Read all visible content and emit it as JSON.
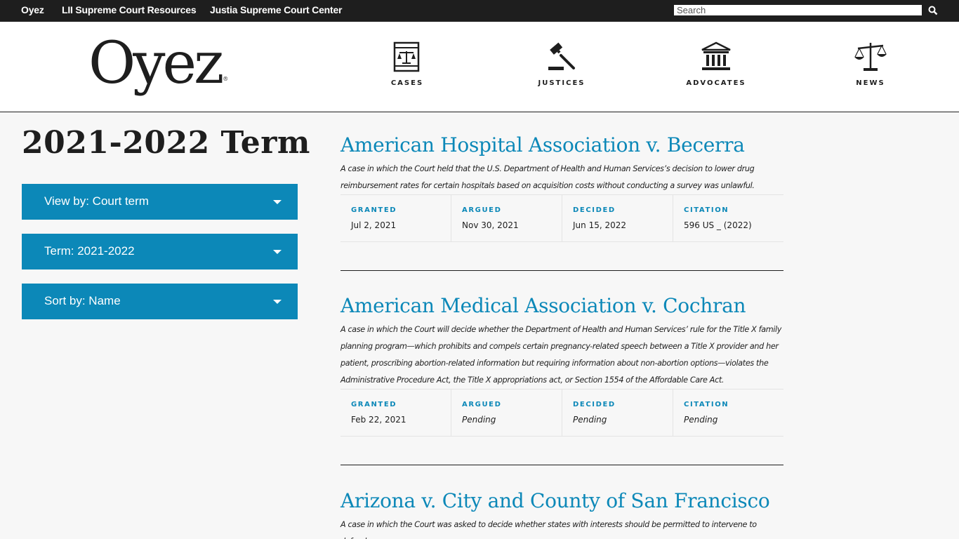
{
  "topbar": {
    "links": [
      "Oyez",
      "LII Supreme Court Resources",
      "Justia Supreme Court Center"
    ],
    "search_placeholder": "Search"
  },
  "header": {
    "logo": "Oyez",
    "nav": [
      "CASES",
      "JUSTICES",
      "ADVOCATES",
      "NEWS"
    ]
  },
  "sidebar": {
    "term_title": "2021-2022 Term",
    "view_by": "View by: Court term",
    "term": "Term: 2021-2022",
    "sort_by": "Sort by: Name"
  },
  "meta_labels": {
    "granted": "GRANTED",
    "argued": "ARGUED",
    "decided": "DECIDED",
    "citation": "CITATION"
  },
  "cases": [
    {
      "title": "American Hospital Association v. Becerra",
      "description": "A case in which the Court held that the U.S. Department of Health and Human Services’s decision to lower drug reimbursement rates for certain hospitals based on acquisition costs without conducting a survey was unlawful.",
      "granted": "Jul 2, 2021",
      "argued": "Nov 30, 2021",
      "decided": "Jun 15, 2022",
      "citation": "596 US _ (2022)"
    },
    {
      "title": "American Medical Association v. Cochran",
      "description": "A case in which the Court will decide whether the Department of Health and Human Services’ rule for the Title X family planning program—which prohibits and compels certain pregnancy-related speech between a Title X provider and her patient, proscribing abortion-related information but requiring information about non-abortion options—violates the Administrative Procedure Act, the Title X appropriations act, or Section 1554 of the Affordable Care Act.",
      "granted": "Feb 22, 2021",
      "argued": "Pending",
      "decided": "Pending",
      "citation": "Pending"
    },
    {
      "title": "Arizona v. City and County of San Francisco",
      "description": "A case in which the Court was asked to decide whether states with interests should be permitted to intervene to defend a"
    }
  ],
  "colors": {
    "accent": "#0c88b8",
    "dark": "#1e1e1e",
    "background": "#f7f7f7"
  }
}
